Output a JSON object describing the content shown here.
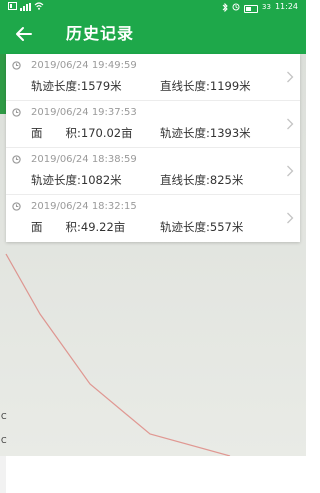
{
  "status_bar": {
    "time": "11:24",
    "battery": "33"
  },
  "header": {
    "title": "历史记录",
    "background_color": "#1ea84a"
  },
  "records": [
    {
      "timestamp": "2019/06/24 19:49:59",
      "left": "轨迹长度:1579米",
      "right": "直线长度:1199米"
    },
    {
      "timestamp": "2019/06/24 19:37:53",
      "left": "面　　积:170.02亩",
      "right": "轨迹长度:1393米"
    },
    {
      "timestamp": "2019/06/24 18:38:59",
      "left": "轨迹长度:1082米",
      "right": "直线长度:825米"
    },
    {
      "timestamp": "2019/06/24 18:32:15",
      "left": "面　　积:49.22亩",
      "right": "轨迹长度:557米"
    }
  ],
  "icons": {
    "back": "arrow-left-icon",
    "record_time": "clock-icon",
    "record_open": "chevron-right-icon"
  }
}
